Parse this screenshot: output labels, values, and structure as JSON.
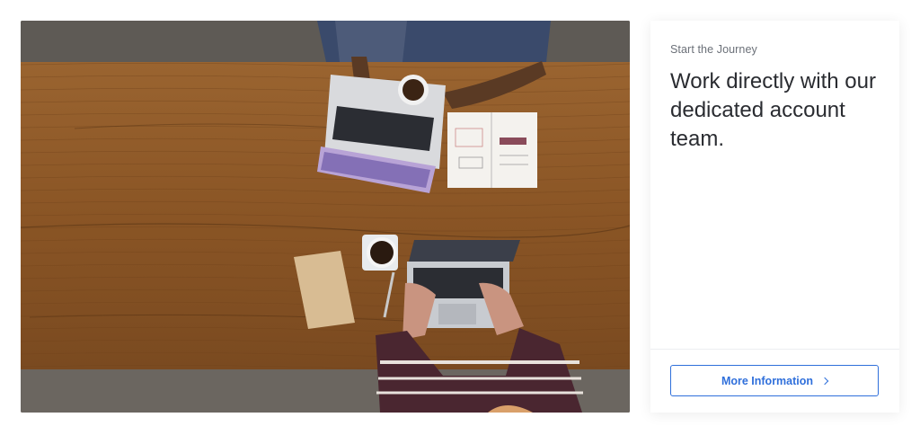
{
  "hero": {
    "image_alt": "Overhead view of two people working on laptops at a wooden table with coffee cups and notebooks"
  },
  "card": {
    "eyebrow": "Start the Journey",
    "title": "Work directly with our dedicated account team.",
    "button_label": "More Information",
    "button_icon": "chevron-right-icon"
  },
  "colors": {
    "accent": "#2f6fdb",
    "title_text": "#2a2c31",
    "eyebrow_text": "#6b7078",
    "table_wood": "#8a5a2b"
  }
}
